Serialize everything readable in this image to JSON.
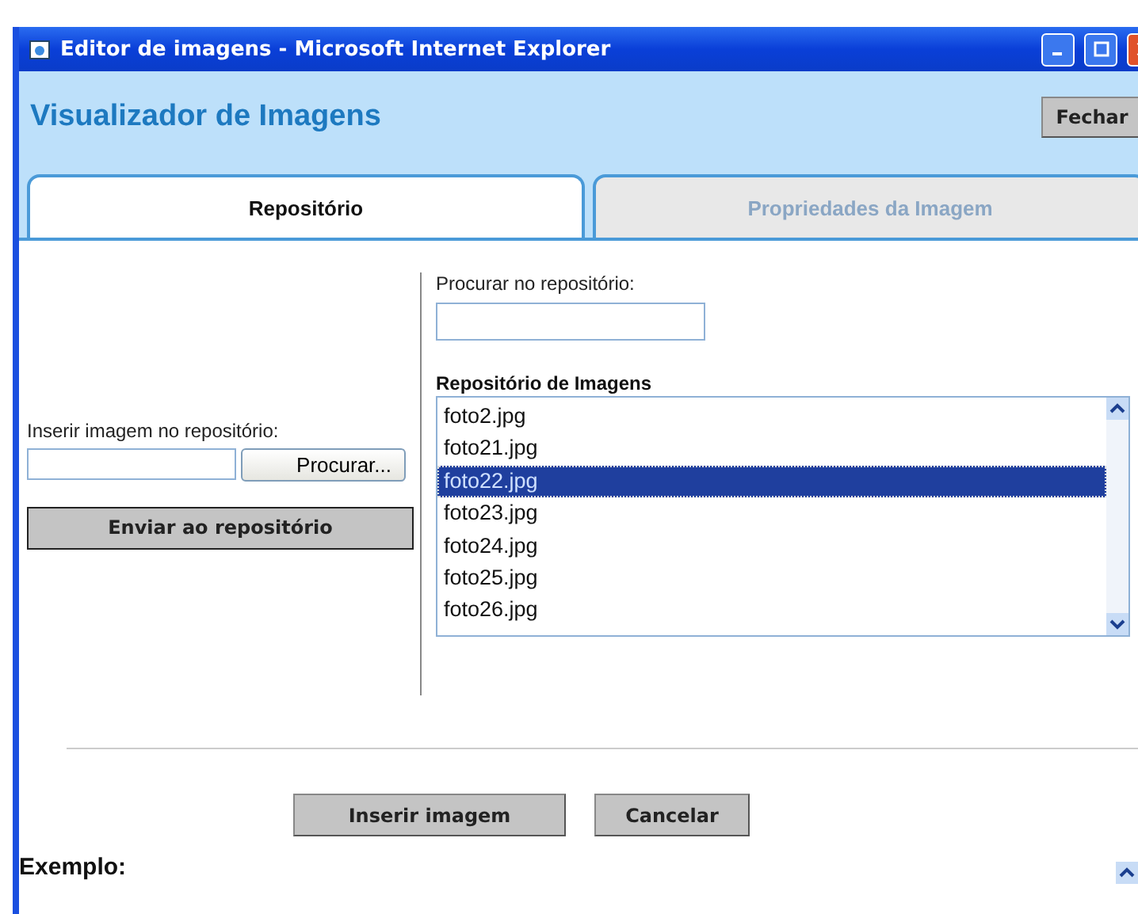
{
  "window": {
    "title": "Editor de imagens - Microsoft Internet Explorer"
  },
  "header": {
    "title": "Visualizador de Imagens",
    "close_button": "Fechar"
  },
  "tabs": [
    {
      "label": "Repositório",
      "selected": true
    },
    {
      "label": "Propriedades da Imagem",
      "selected": false
    }
  ],
  "upload": {
    "label": "Inserir imagem no repositório:",
    "browse_button": "Procurar...",
    "send_button": "Enviar ao repositório"
  },
  "search": {
    "label": "Procurar no repositório:"
  },
  "repository": {
    "title": "Repositório de Imagens",
    "items": [
      {
        "name": "foto2.jpg",
        "selected": false
      },
      {
        "name": "foto21.jpg",
        "selected": false
      },
      {
        "name": "foto22.jpg",
        "selected": true
      },
      {
        "name": "foto23.jpg",
        "selected": false
      },
      {
        "name": "foto24.jpg",
        "selected": false
      },
      {
        "name": "foto25.jpg",
        "selected": false
      },
      {
        "name": "foto26.jpg",
        "selected": false
      }
    ]
  },
  "buttons": [
    "Inserir imagem",
    "Cancelar"
  ],
  "example": {
    "label": "Exemplo:"
  }
}
